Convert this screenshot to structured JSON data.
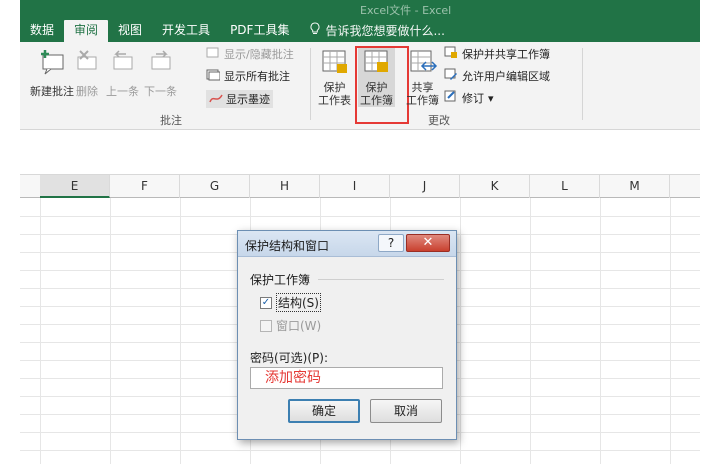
{
  "window": {
    "title": "Excel文件 - Excel"
  },
  "tabs": [
    {
      "label": "数据"
    },
    {
      "label": "审阅",
      "active": true
    },
    {
      "label": "视图"
    },
    {
      "label": "开发工具"
    },
    {
      "label": "PDF工具集"
    }
  ],
  "tell_me": {
    "placeholder": "告诉我您想要做什么..."
  },
  "ribbon": {
    "comments_group": {
      "label": "批注",
      "new_comment": "新建批注",
      "delete": "删除",
      "previous": "上一条",
      "next": "下一条",
      "show_hide": "显示/隐藏批注",
      "show_all": "显示所有批注",
      "show_ink": "显示墨迹"
    },
    "changes_group": {
      "label": "更改",
      "protect_sheet": [
        "保护",
        "工作表"
      ],
      "protect_workbook": [
        "保护",
        "工作簿"
      ],
      "share_workbook": [
        "共享",
        "工作簿"
      ],
      "protect_share": "保护并共享工作簿",
      "allow_edit_ranges": "允许用户编辑区域",
      "track_changes": "修订"
    }
  },
  "grid": {
    "columns": [
      "E",
      "F",
      "G",
      "H",
      "I",
      "J",
      "K",
      "L",
      "M"
    ],
    "selected_column": "E"
  },
  "dialog": {
    "title": "保护结构和窗口",
    "help": "?",
    "section": "保护工作簿",
    "structure_label": "结构(S)",
    "structure_checked": true,
    "window_label": "窗口(W)",
    "window_checked": false,
    "password_label": "密码(可选)(P):",
    "password_value": "添加密码",
    "ok": "确定",
    "cancel": "取消"
  },
  "colors": {
    "excel_green": "#217346",
    "highlight_red": "#e53935"
  }
}
